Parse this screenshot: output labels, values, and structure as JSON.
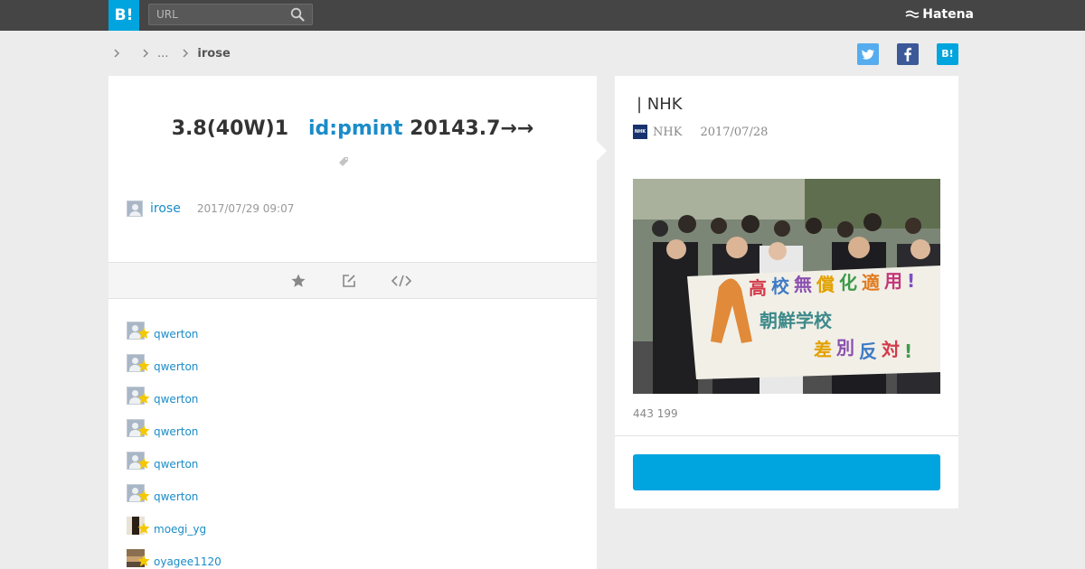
{
  "header": {
    "logo_text": "B!",
    "search_placeholder": "URL",
    "brand": "Hatena"
  },
  "breadcrumb": {
    "items": [
      "",
      "..."
    ],
    "current": "irose"
  },
  "share": {
    "hatena_label": "B!"
  },
  "comment": {
    "text_part1": "3.8(40W)1",
    "user_mention": "id:pmint",
    "text_part2": "20143.7→→",
    "user": "irose",
    "timestamp": "2017/07/29 09:07"
  },
  "stars": [
    {
      "user": "qwerton"
    },
    {
      "user": "qwerton"
    },
    {
      "user": "qwerton"
    },
    {
      "user": "qwerton"
    },
    {
      "user": "qwerton"
    },
    {
      "user": "qwerton"
    },
    {
      "user": "moegi_yg"
    },
    {
      "user": "oyagee1120"
    }
  ],
  "entry": {
    "title": "| NHK",
    "favicon_text": "NHK",
    "site": "NHK",
    "date": "2017/07/28",
    "image_banner": {
      "line1": [
        "高",
        "校",
        "無",
        "償",
        "化",
        "適",
        "用",
        "!"
      ],
      "line2": "朝鮮学校",
      "line3": [
        "差",
        "別",
        "反",
        "対",
        "!"
      ]
    },
    "stats": "443 199",
    "button_label": ""
  },
  "colors": {
    "topbar": "#454545",
    "accent": "#00a4de",
    "link": "#1a8cc8",
    "background": "#ececec",
    "star": "#f5c800",
    "twitter": "#55acee",
    "facebook": "#3b5998"
  },
  "icons": {
    "search": "search-icon",
    "brand": "hatena-bird-icon",
    "breadcrumb": "chevron-right-icon",
    "tag": "tag-icon",
    "star": "star-icon",
    "edit": "edit-icon",
    "embed": "code-icon",
    "twitter": "twitter-icon",
    "facebook": "facebook-icon"
  }
}
